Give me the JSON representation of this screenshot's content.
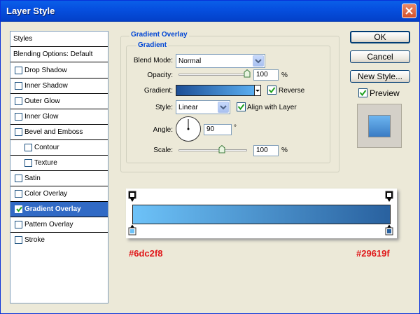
{
  "window": {
    "title": "Layer Style"
  },
  "styles_list": {
    "header": "Styles",
    "blending": "Blending Options: Default",
    "items": [
      {
        "label": "Drop Shadow",
        "checked": false
      },
      {
        "label": "Inner Shadow",
        "checked": false
      },
      {
        "label": "Outer Glow",
        "checked": false
      },
      {
        "label": "Inner Glow",
        "checked": false
      },
      {
        "label": "Bevel and Emboss",
        "checked": false
      },
      {
        "label": "Contour",
        "checked": false
      },
      {
        "label": "Texture",
        "checked": false
      },
      {
        "label": "Satin",
        "checked": false
      },
      {
        "label": "Color Overlay",
        "checked": false
      },
      {
        "label": "Gradient Overlay",
        "checked": true
      },
      {
        "label": "Pattern Overlay",
        "checked": false
      },
      {
        "label": "Stroke",
        "checked": false
      }
    ]
  },
  "buttons": {
    "ok": "OK",
    "cancel": "Cancel",
    "new_style": "New Style...",
    "preview": "Preview"
  },
  "gradient_overlay": {
    "section_title": "Gradient Overlay",
    "group_title": "Gradient",
    "blend_mode_label": "Blend Mode:",
    "blend_mode": "Normal",
    "opacity_label": "Opacity:",
    "opacity": "100",
    "percent": "%",
    "gradient_label": "Gradient:",
    "reverse_label": "Reverse",
    "style_label": "Style:",
    "style": "Linear",
    "align_label": "Align with Layer",
    "angle_label": "Angle:",
    "angle": "90",
    "degree": "°",
    "scale_label": "Scale:",
    "scale": "100"
  },
  "gradient_editor": {
    "left_color": "#6dc2f8",
    "right_color": "#29619f"
  }
}
